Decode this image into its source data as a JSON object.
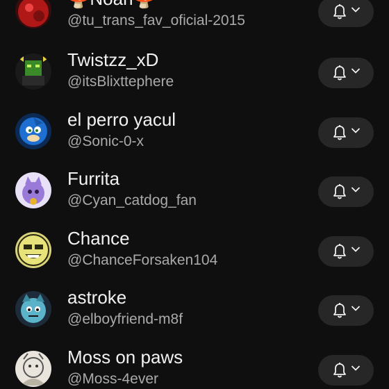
{
  "subscriptions": [
    {
      "name": "🍄Noah🍄",
      "handle": "@tu_trans_fav_oficial-2015",
      "avatar_icon": "red-creature-avatar",
      "accent": "#b01818"
    },
    {
      "name": "Twistzz_xD",
      "handle": "@itsBlixttephere",
      "avatar_icon": "green-robot-avatar",
      "accent": "#3a8a2a"
    },
    {
      "name": "el perro yacul",
      "handle": "@Sonic-0-x",
      "avatar_icon": "blue-hedgehog-avatar",
      "accent": "#1e6fd0"
    },
    {
      "name": "Furrita",
      "handle": "@Cyan_catdog_fan",
      "avatar_icon": "purple-cat-avatar",
      "accent": "#9a7ad8"
    },
    {
      "name": "Chance",
      "handle": "@ChanceForsaken104",
      "avatar_icon": "yellow-face-avatar",
      "accent": "#e8e27a"
    },
    {
      "name": "astroke",
      "handle": "@elboyfriend-m8f",
      "avatar_icon": "teal-creature-avatar",
      "accent": "#5ab3c8"
    },
    {
      "name": "Moss on paws",
      "handle": "@Moss-4ever",
      "avatar_icon": "sketch-avatar",
      "accent": "#b9b3a4"
    }
  ],
  "notification_button": {
    "icon": "bell-icon",
    "dropdown_icon": "chevron-down-icon"
  },
  "colors": {
    "background": "#0f0f0f",
    "pill": "#272727",
    "name": "#f1f1f1",
    "handle": "#aaaaaa"
  }
}
